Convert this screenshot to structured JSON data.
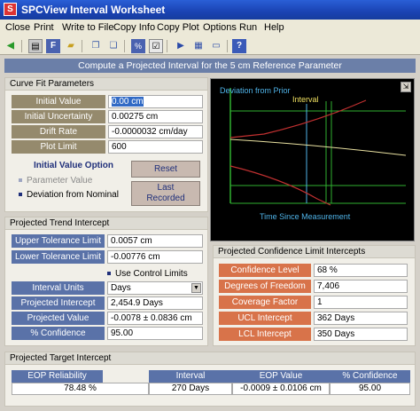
{
  "window": {
    "title": "SPCView Interval Worksheet",
    "icon": "spc-icon"
  },
  "menu": [
    "Close",
    "Print",
    "Write to File",
    "Copy Info",
    "Copy Plot",
    "Options",
    "Run",
    "Help"
  ],
  "banner": "Compute a Projected Interval for the 5 cm Reference Parameter",
  "curve_fit": {
    "header": "Curve Fit Parameters",
    "rows": [
      {
        "label": "Initial Value",
        "value": "0.00 cm"
      },
      {
        "label": "Initial Uncertainty",
        "value": "0.00275 cm"
      },
      {
        "label": "Drift Rate",
        "value": "-0.0000032 cm/day"
      },
      {
        "label": "Plot Limit",
        "value": "600"
      }
    ],
    "option_title": "Initial Value Option",
    "options": [
      {
        "label": "Parameter Value",
        "selected": false
      },
      {
        "label": "Deviation from Nominal",
        "selected": true
      }
    ],
    "reset_label": "Reset",
    "last_recorded_label_1": "Last",
    "last_recorded_label_2": "Recorded"
  },
  "chart": {
    "ylabel": "Deviation from Prior",
    "xlabel": "Time Since Measurement",
    "annotation": "Interval",
    "button_symbol": "⇲"
  },
  "trend": {
    "header": "Projected Trend Intercept",
    "upper_label": "Upper Tolerance Limit",
    "upper_value": "0.0057 cm",
    "lower_label": "Lower Tolerance Limit",
    "lower_value": "-0.00776 cm",
    "control_limits_label": "Use Control Limits",
    "rows": [
      {
        "label": "Interval Units",
        "value": "Days"
      },
      {
        "label": "Projected Intercept",
        "value": "2,454.9 Days"
      },
      {
        "label": "Projected Value",
        "value": "-0.0078 ± 0.0836 cm"
      },
      {
        "label": "% Confidence",
        "value": "95.00"
      }
    ]
  },
  "confidence": {
    "header": "Projected Confidence Limit Intercepts",
    "rows": [
      {
        "label": "Confidence Level",
        "value": "68 %"
      },
      {
        "label": "Degrees of Freedom",
        "value": "7,406"
      },
      {
        "label": "Coverage Factor",
        "value": "1"
      },
      {
        "label": "UCL Intercept",
        "value": "362 Days"
      },
      {
        "label": "LCL Intercept",
        "value": "350 Days"
      }
    ]
  },
  "target": {
    "header": "Projected Target Intercept",
    "columns": [
      "EOP Reliability",
      "Interval",
      "EOP Value",
      "% Confidence"
    ],
    "values": [
      "78.48 %",
      "270 Days",
      "-0.0009 ± 0.0106 cm",
      "95.00"
    ]
  },
  "colors": {
    "accent_blue": "#5a72a8",
    "olive": "#958a6d",
    "orange": "#d8734a",
    "chart_red": "#c03030",
    "chart_green": "#30b030",
    "chart_cyan": "#4fb3e8",
    "chart_yellow": "#e8e0a0"
  }
}
